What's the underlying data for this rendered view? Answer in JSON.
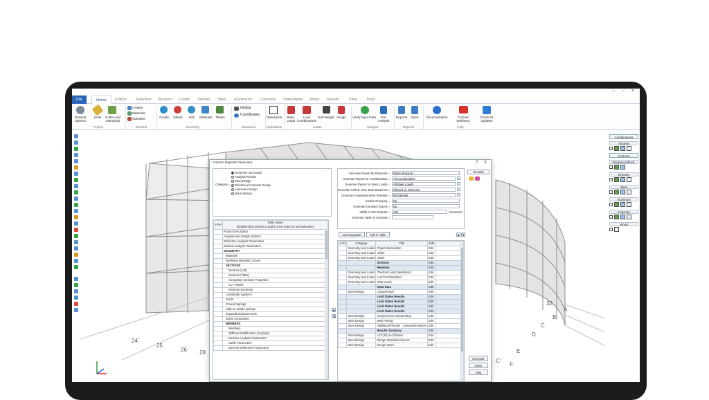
{
  "window": {
    "min": "–",
    "max": "▫",
    "close": "×"
  },
  "menu": [
    "File",
    "Home",
    "Edition",
    "Selection",
    "Sections",
    "Loads",
    "Seismic",
    "Steel",
    "Aluminium",
    "Concrete",
    "Slabs/Walls",
    "Wood",
    "Results",
    "View",
    "Tools"
  ],
  "ribbon": {
    "project": {
      "general_options": "General Options",
      "units": "Units",
      "codes": "Codes and Standards",
      "label": "Project"
    },
    "general": {
      "grades": "Grades",
      "materials": "Materials",
      "standard": "Standard",
      "label": "General"
    },
    "geometry": {
      "create": "Create",
      "delete": "Delete",
      "edit": "Edit",
      "attributes": "Attributes",
      "tables": "Tables",
      "label": "Geometry"
    },
    "measures": {
      "global": "Global",
      "coordinates": "Coordinates",
      "label": "Measures"
    },
    "operations": {
      "operations": "Operations",
      "label": "Operations"
    },
    "loads": {
      "basic": "Basic Loads",
      "load_comb": "Load Combinations",
      "self_weight": "Self-Weight",
      "assign": "Assign",
      "label": "Loads"
    },
    "analysis": {
      "verify": "Verify Input Data",
      "run": "Run Analysis",
      "label": "Analysis"
    },
    "reports": {
      "reports": "Reports",
      "open": "Open",
      "label": "Reports"
    },
    "help": {
      "documentation": "Documentation",
      "tutorial": "Tutorial Webinars",
      "check": "Check for Updates",
      "label": "Help"
    }
  },
  "right_panel": {
    "combinations": "Combinations",
    "analysis": "Analysis",
    "contours": "Contours",
    "frequency": "Frequency/Buck.",
    "dynamic": "Dynamic",
    "steel": "Steel",
    "aluminum": "Aluminum",
    "concrete": "Concrete",
    "wood": "Wood"
  },
  "grid_labels": [
    "32",
    "A",
    "B",
    "C",
    "D",
    "E",
    "F",
    "25",
    "26",
    "28",
    "24'",
    "C'"
  ],
  "dialog": {
    "title": "Custom Reports Generator",
    "help": "?",
    "close": "X",
    "category_label": "Category =",
    "categories": [
      "Geometry and Loads",
      "Analysis Results",
      "Steel Design",
      "Reinforced Concrete Design",
      "Aluminum Design",
      "Wood Design"
    ],
    "left_table": {
      "col1": "S RH",
      "col2": "Table Name",
      "col2_hint": "(Double-click an item to add it to the report or use selection)",
      "rows": [
        "Project Description",
        "Analysis and Design Options",
        "Deflection Analysis Parameters",
        "Seismic Analysis Parameters",
        "GEOMETRY",
        "Materials",
        "Nonlinear Behavior Curves",
        "SECTIONS",
        "Sections (List)",
        "Sections (Table)",
        "Composite Sections Properties",
        "CLT Panels",
        "Sections Summary",
        "Coordinate Systems",
        "Joints",
        "Ground Springs",
        "Slab-on-Grade Springs",
        "Imposed Displacements",
        "Joints Constraints",
        "MEMBERS",
        "Members",
        "Stiffness Modification (Analysis)",
        "Member Analysis Parameters",
        "Cable Parameters",
        "Element Deflection Parameters"
      ]
    },
    "fields": [
      {
        "label": "Generate Report for Elements =",
        "value": "Entire structure"
      },
      {
        "label": "Generate Report for Combinations =",
        "value": "All Combinations"
      },
      {
        "label": "Generate Report for Basic Loads =",
        "value": "All Basic Loads"
      },
      {
        "label": "Generate Critical Limit State Based On =",
        "value": "Filtered on Elements"
      },
      {
        "label": "Generate Envelopes when Possible =",
        "value": "By Element"
      },
      {
        "label": "Enable Grouping =",
        "value": "No"
      },
      {
        "label": "Generate Compact Report =",
        "value": "No"
      },
      {
        "label": "Width of Text Reports =",
        "value": "132"
      },
      {
        "label": "Generate Table of Contents =",
        "value": ""
      }
    ],
    "characters": "Characters",
    "security": "Security",
    "add_separator": "Add Separator",
    "edit_in_table": "Edit in Table",
    "right_table": {
      "col1": "1 2/1",
      "col2": "Category",
      "col3": "Title",
      "col4": "Edit",
      "rows": [
        [
          "Geometry and Loads",
          "Project Description",
          "Edit",
          ""
        ],
        [
          "Geometry and Loads",
          "Joints",
          "Edit",
          ""
        ],
        [
          "Geometry and Loads",
          "Joints",
          "Edit",
          ""
        ],
        [
          "",
          "Sections",
          "Edit",
          "h"
        ],
        [
          "",
          "Members",
          "Edit",
          "h"
        ],
        [
          "Geometry and Loads",
          "Thermal Loads (Members)",
          "Edit",
          ""
        ],
        [
          "Geometry and Loads",
          "Load Combinations",
          "Edit",
          ""
        ],
        [
          "Geometry and Loads",
          "Joint Loads",
          "Edit",
          ""
        ],
        [
          "",
          "Input Data",
          "Edit",
          "h"
        ],
        [
          "Steel Design",
          "Compressive",
          "Edit",
          ""
        ],
        [
          "",
          "Limit States Results",
          "Edit",
          "h"
        ],
        [
          "",
          "Limit States Results",
          "Edit",
          "h"
        ],
        [
          "",
          "Limit States Results",
          "Edit",
          "h"
        ],
        [
          "",
          "Limit States Results",
          "Edit",
          "h"
        ],
        [
          "Steel Design",
          "Compression and Bending",
          "Edit",
          ""
        ],
        [
          "Steel Design",
          "Web Flexing",
          "Edit",
          ""
        ],
        [
          "Steel Design",
          "Additional Results - Composite Beams",
          "Edit",
          ""
        ],
        [
          "",
          "Results Summary",
          "Edit",
          "h"
        ],
        [
          "Steel Design",
          "L/Cf (Fl) at Chickens",
          "Edit",
          ""
        ],
        [
          "Steel Design",
          "Design Standard Clauses",
          "Edit",
          ""
        ],
        [
          "Steel Design",
          "Design Notes",
          "Edit",
          ""
        ]
      ]
    },
    "generate": "Generate",
    "close_btn": "Close",
    "help_btn": "Help"
  }
}
